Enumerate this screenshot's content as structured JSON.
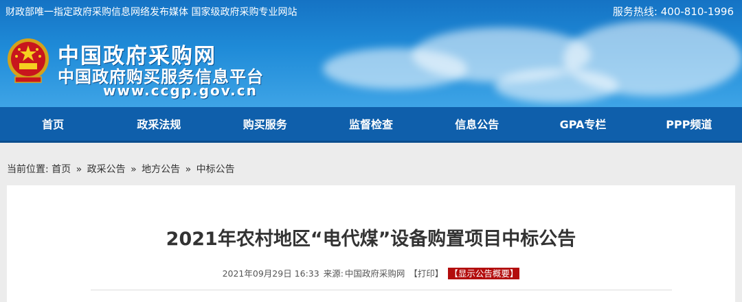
{
  "topbar": {
    "left_text": "财政部唯一指定政府采购信息网络发布媒体 国家级政府采购专业网站",
    "hotline_label": "服务热线:",
    "hotline_number": "400-810-1996"
  },
  "logo": {
    "title": "中国政府采购网",
    "subtitle": "中国政府购买服务信息平台",
    "url": "www.ccgp.gov.cn"
  },
  "nav": {
    "items": [
      "首页",
      "政采法规",
      "购买服务",
      "监督检查",
      "信息公告",
      "GPA专栏",
      "PPP频道"
    ]
  },
  "breadcrumb": {
    "prefix": "当前位置:",
    "items": [
      "首页",
      "政采公告",
      "地方公告",
      "中标公告"
    ],
    "separator": "»"
  },
  "article": {
    "title": "2021年农村地区“电代煤”设备购置项目中标公告",
    "date": "2021年09月29日 16:33",
    "source_label": "来源:",
    "source": "中国政府采购网",
    "print_label": "【打印】",
    "summary_button": "【显示公告概要】"
  },
  "colors": {
    "nav_bg": "#0f5fab",
    "banner_bg": "#1f8bd8",
    "badge_bg": "#b30d0d"
  }
}
